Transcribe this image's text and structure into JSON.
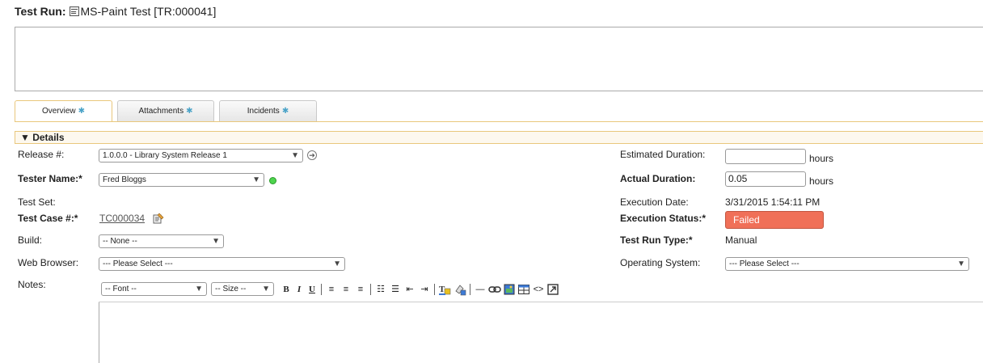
{
  "header": {
    "label": "Test Run:",
    "name": "MS-Paint Test [TR:000041]"
  },
  "tabs": [
    {
      "label": "Overview",
      "star": "✱",
      "active": true
    },
    {
      "label": "Attachments",
      "star": "✱",
      "active": false
    },
    {
      "label": "Incidents",
      "star": "✱",
      "active": false
    }
  ],
  "details": {
    "header": "▼ Details",
    "release_label": "Release #:",
    "release_value": "1.0.0.0 - Library System Release 1",
    "tester_label": "Tester Name:*",
    "tester_value": "Fred Bloggs",
    "testset_label": "Test Set:",
    "testcase_label": "Test Case #:*",
    "testcase_value": "TC000034",
    "build_label": "Build:",
    "build_value": "-- None --",
    "browser_label": "Web Browser:",
    "browser_value": "--- Please Select ---",
    "notes_label": "Notes:",
    "est_duration_label": "Estimated Duration:",
    "est_duration_value": "",
    "est_duration_unit": "hours",
    "actual_duration_label": "Actual Duration:",
    "actual_duration_value": "0.05",
    "actual_duration_unit": "hours",
    "exec_date_label": "Execution Date:",
    "exec_date_value": "3/31/2015 1:54:11 PM",
    "exec_status_label": "Execution Status:*",
    "exec_status_value": "Failed",
    "run_type_label": "Test Run Type:*",
    "run_type_value": "Manual",
    "os_label": "Operating System:",
    "os_value": "--- Please Select ---"
  },
  "editor_toolbar": {
    "font_value": "-- Font --",
    "size_value": "-- Size --",
    "bold": "B",
    "italic": "I",
    "underline": "U"
  },
  "colors": {
    "accent_border": "#e9c77c",
    "failed": "#f07058",
    "tab_star": "#4aa3c8"
  }
}
